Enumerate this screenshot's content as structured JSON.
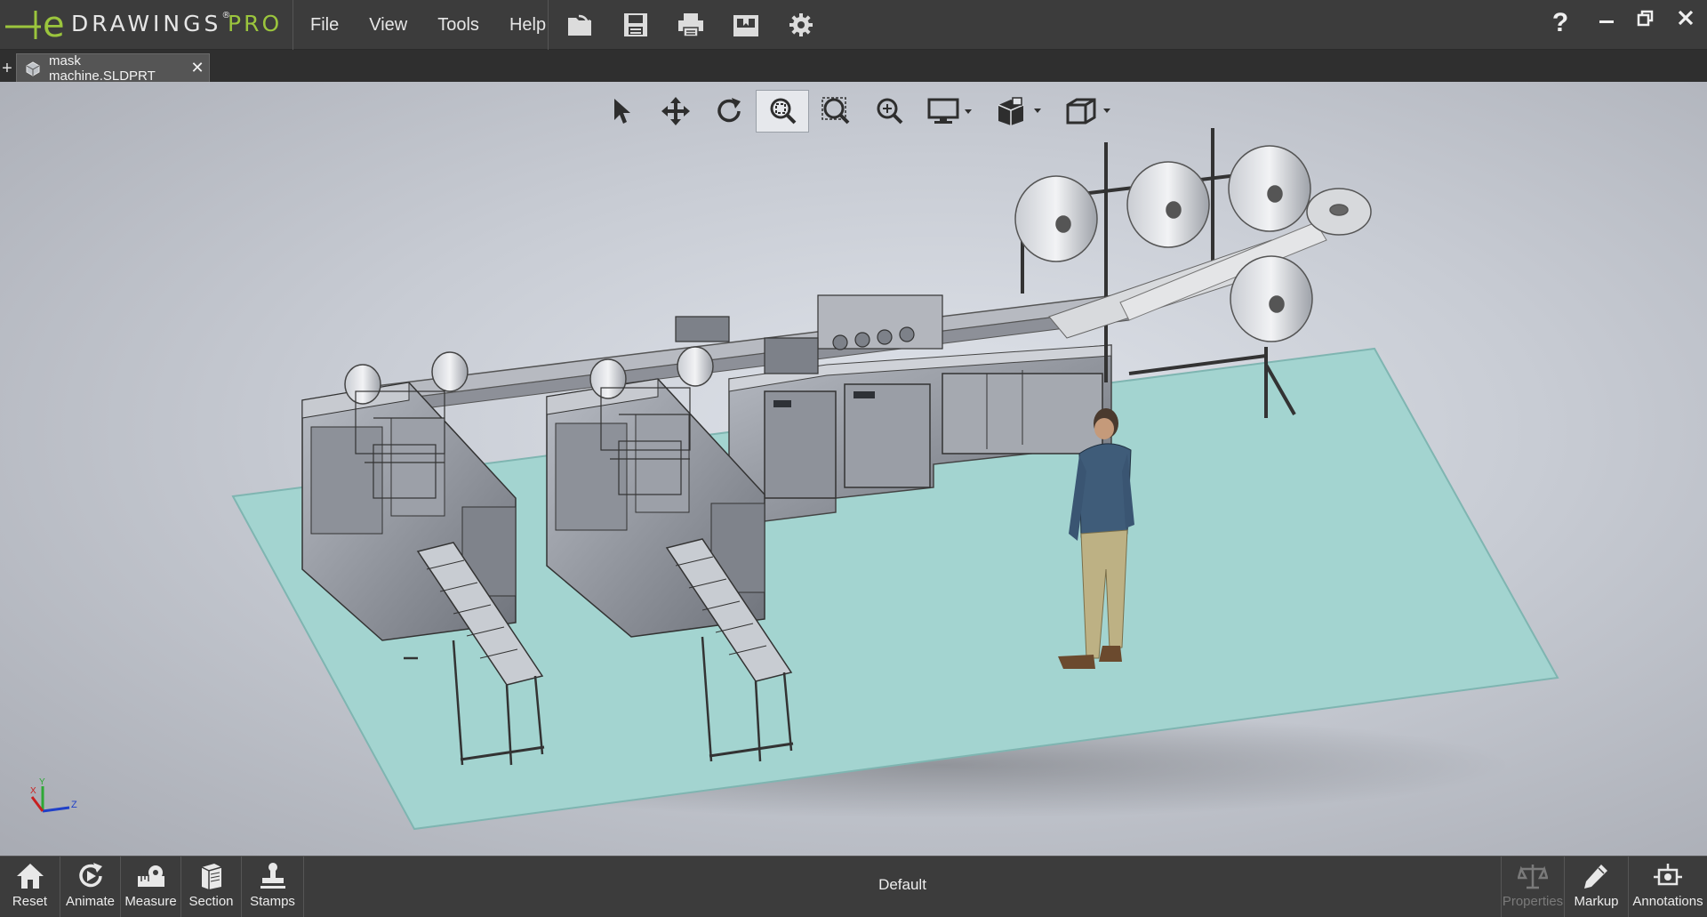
{
  "app": {
    "brand": "DRAWINGS",
    "edition": "PRO",
    "colors": {
      "accent": "#9bc53d",
      "chrome": "#3c3c3c",
      "floor": "#9fcfcc"
    }
  },
  "menu": {
    "items": [
      "File",
      "View",
      "Tools",
      "Help"
    ]
  },
  "toolbar": {
    "icons": [
      "open-icon",
      "save-icon",
      "print-icon",
      "publish-icon",
      "settings-icon"
    ]
  },
  "window": {
    "help_label": "?"
  },
  "tabs": {
    "documents": [
      {
        "label": "mask machine.SLDPRT",
        "active": true
      }
    ],
    "add_label": "+"
  },
  "view_toolbar": {
    "tools": [
      "select-icon",
      "pan-icon",
      "rotate-icon",
      "zoom-to-fit-icon",
      "zoom-to-area-icon",
      "zoom-in-out-icon",
      "display-style-icon",
      "view-orientation-icon",
      "standard-views-icon"
    ],
    "active": "zoom-to-fit-icon"
  },
  "triad": {
    "x_label": "X",
    "y_label": "Y",
    "z_label": "Z"
  },
  "bottom_bar": {
    "left_tools": [
      {
        "label": "Reset",
        "icon": "home-icon"
      },
      {
        "label": "Animate",
        "icon": "animate-icon"
      },
      {
        "label": "Measure",
        "icon": "measure-icon"
      },
      {
        "label": "Section",
        "icon": "section-icon"
      },
      {
        "label": "Stamps",
        "icon": "stamp-icon"
      }
    ],
    "configuration": "Default",
    "right_tools": [
      {
        "label": "Properties",
        "icon": "balance-icon",
        "enabled": false
      },
      {
        "label": "Markup",
        "icon": "pencil-icon",
        "enabled": true
      },
      {
        "label": "Annotations",
        "icon": "annotations-icon",
        "enabled": true
      }
    ]
  }
}
